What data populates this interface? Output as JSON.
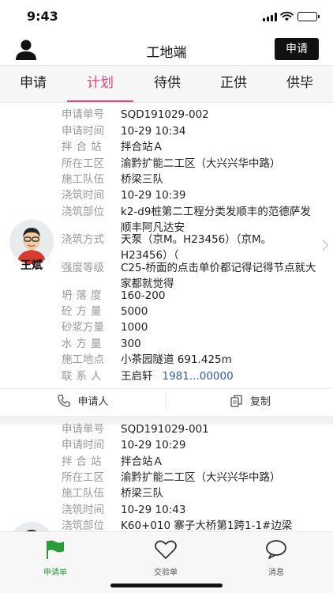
{
  "status_bar": {
    "time": "9:43"
  },
  "header": {
    "title": "工地端",
    "apply_button": "申请"
  },
  "tabs": [
    {
      "label": "申请"
    },
    {
      "label": "计划",
      "active": true
    },
    {
      "label": "待供"
    },
    {
      "label": "正供"
    },
    {
      "label": "供毕"
    }
  ],
  "colors": {
    "accent": "#e8437e",
    "active_green": "#2a9d3a",
    "phone_link": "#2f5bb0"
  },
  "cards": [
    {
      "person_name": "王斌",
      "fields": [
        {
          "label": "申请单号",
          "value": "SQD191029-002"
        },
        {
          "label": "申请时间",
          "value": "10-29 10:34"
        },
        {
          "label": "拌合站",
          "value": "拌合站Ａ"
        },
        {
          "label": "所在工区",
          "value": "渝黔扩能二工区（大兴兴华中路）"
        },
        {
          "label": "施工队伍",
          "value": "桥梁三队"
        },
        {
          "label": "浇筑时间",
          "value": "10-29 10:39"
        },
        {
          "label": "浇筑部位",
          "value": "k2-d9桩第二工程分类发顺丰的范德萨发顺丰阿凡达安"
        },
        {
          "label": "浇筑方式",
          "value": "天泵（京M。H23456）（京M。H23456）（"
        },
        {
          "label": "强度等级",
          "value": "C25-桥面的点击单价都记得记得节点就大家都就觉得"
        },
        {
          "label": "坍落度",
          "value": "160-200"
        },
        {
          "label": "砼方量",
          "value": "5000"
        },
        {
          "label": "砂浆方量",
          "value": "1000"
        },
        {
          "label": "水方量",
          "value": "300"
        },
        {
          "label": "施工地点",
          "value": "小茶园隧道 691.425m"
        },
        {
          "label": "联系人",
          "value": "王启轩",
          "phone": "1981...00000"
        }
      ],
      "actions": {
        "applicant": "申请人",
        "copy": "复制"
      }
    },
    {
      "fields": [
        {
          "label": "申请单号",
          "value": "SQD191029-001"
        },
        {
          "label": "申请时间",
          "value": "10-29 10:29"
        },
        {
          "label": "拌合站",
          "value": "拌合站Ａ"
        },
        {
          "label": "所在工区",
          "value": "渝黔扩能二工区（大兴兴华中路）"
        },
        {
          "label": "施工队伍",
          "value": "桥梁三队"
        },
        {
          "label": "浇筑时间",
          "value": "10-29 10:43"
        },
        {
          "label": "浇筑部位",
          "value": "K60+010 寨子大桥第1跨1-1#边梁"
        }
      ]
    }
  ],
  "bottom_nav": [
    {
      "label": "申请单",
      "icon": "flag-icon",
      "active": true
    },
    {
      "label": "交验单",
      "icon": "heart-icon"
    },
    {
      "label": "消息",
      "icon": "chat-bubble-icon"
    }
  ]
}
